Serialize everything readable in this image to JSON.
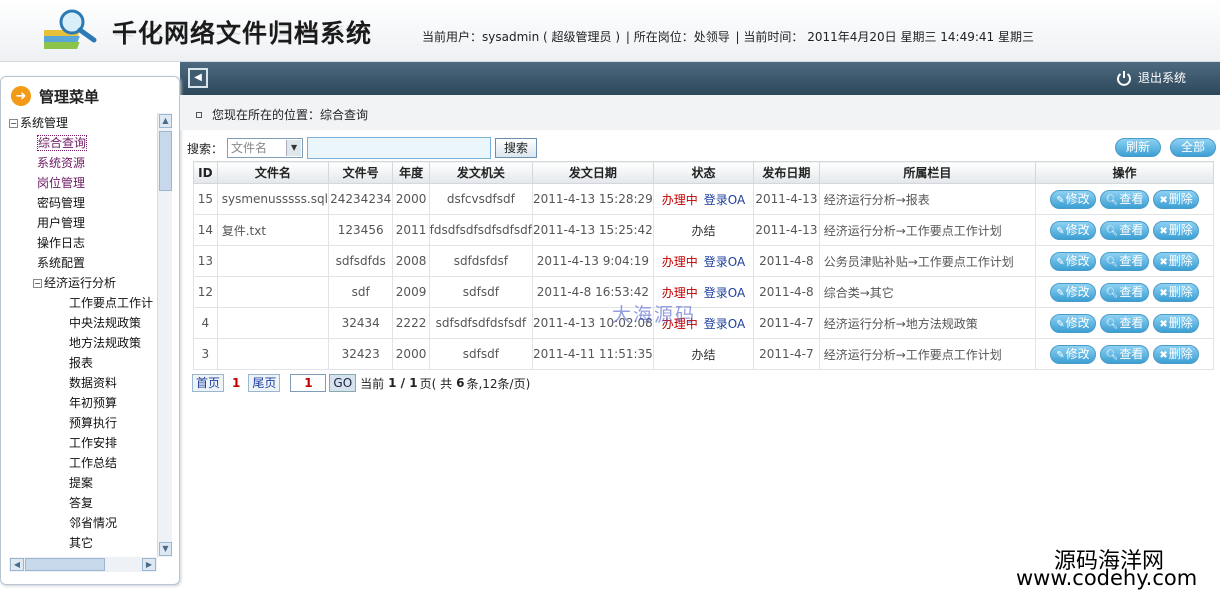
{
  "header": {
    "app_title": "千化网络文件归档系统",
    "current_user": "当前用户：sysadmin ( 超级管理员  )",
    "position": "| 所在岗位：处领导",
    "time": "| 当前时间：  2011年4月20日  星期三  14:49:41 星期三"
  },
  "topbar": {
    "logout_label": "退出系统"
  },
  "sidebar": {
    "title": "管理菜单",
    "root": "系统管理",
    "items": [
      "综合查询",
      "系统资源",
      "岗位管理",
      "密码管理",
      "用户管理",
      "操作日志",
      "系统配置"
    ],
    "group": "经济运行分析",
    "subitems": [
      "工作要点工作计",
      "中央法规政策",
      "地方法规政策",
      "报表",
      "数据资料",
      "年初预算",
      "预算执行",
      "工作安排",
      "工作总结",
      "提案",
      "答复",
      "邻省情况",
      "其它"
    ]
  },
  "breadcrumb": "您现在所在的位置：综合查询",
  "search": {
    "label": "搜索：",
    "field_select": "文件名",
    "button": "搜索",
    "refresh": "刷新",
    "all": "全部"
  },
  "table": {
    "headers": [
      "ID",
      "文件名",
      "文件号",
      "年度",
      "发文机关",
      "发文日期",
      "状态",
      "发布日期",
      "所属栏目",
      "操作"
    ],
    "rows": [
      {
        "id": "15",
        "name": "sysmenusssss.sql",
        "num": "24234234",
        "year": "2000",
        "org": "dsfcvsdfsdf",
        "date": "2011-4-13 15:28:29",
        "status": "办理中",
        "status2": "登录OA",
        "pub": "2011-4-13",
        "column": "经济运行分析→报表"
      },
      {
        "id": "14",
        "name": "复件.txt",
        "num": "123456",
        "year": "2011",
        "org": "fdsdfsdfsdfsdfsdf",
        "date": "2011-4-13 15:25:42",
        "status": "办结",
        "status2": "",
        "pub": "2011-4-13",
        "column": "经济运行分析→工作要点工作计划"
      },
      {
        "id": "13",
        "name": "",
        "num": "sdfsdfds",
        "year": "2008",
        "org": "sdfdsfdsf",
        "date": "2011-4-13 9:04:19",
        "status": "办理中",
        "status2": "登录OA",
        "pub": "2011-4-8",
        "column": "公务员津贴补贴→工作要点工作计划"
      },
      {
        "id": "12",
        "name": "",
        "num": "sdf",
        "year": "2009",
        "org": "sdfsdf",
        "date": "2011-4-8 16:53:42",
        "status": "办理中",
        "status2": "登录OA",
        "pub": "2011-4-8",
        "column": "综合类→其它"
      },
      {
        "id": "4",
        "name": "",
        "num": "32434",
        "year": "2222",
        "org": "sdfsdfsdfdsfsdf",
        "date": "2011-4-13 10:02:08",
        "status": "办理中",
        "status2": "登录OA",
        "pub": "2011-4-7",
        "column": "经济运行分析→地方法规政策"
      },
      {
        "id": "3",
        "name": "",
        "num": "32423",
        "year": "2000",
        "org": "sdfsdf",
        "date": "2011-4-11 11:51:35",
        "status": "办结",
        "status2": "",
        "pub": "2011-4-7",
        "column": "经济运行分析→工作要点工作计划"
      }
    ],
    "ops": {
      "edit": "修改",
      "view": "查看",
      "delete": "删除"
    }
  },
  "pager": {
    "first": "首页",
    "current_marker": "1",
    "last": "尾页",
    "input_value": "1",
    "go": "GO",
    "summary_prefix": "当前",
    "summary_page": "1 / 1",
    "summary_mid": "页( 共",
    "summary_count": "6",
    "summary_rest": "条,12条/页)"
  },
  "watermarks": {
    "center": "大海源码",
    "corner_cn": "源码海洋网",
    "corner_url": "www.codehy.com"
  },
  "colors": {
    "topbar": "#2d4759",
    "accent_orange": "#f39b16",
    "button_blue": "#3c9fd3",
    "status_red": "#c00000",
    "status_blue": "#1d3f9c"
  }
}
